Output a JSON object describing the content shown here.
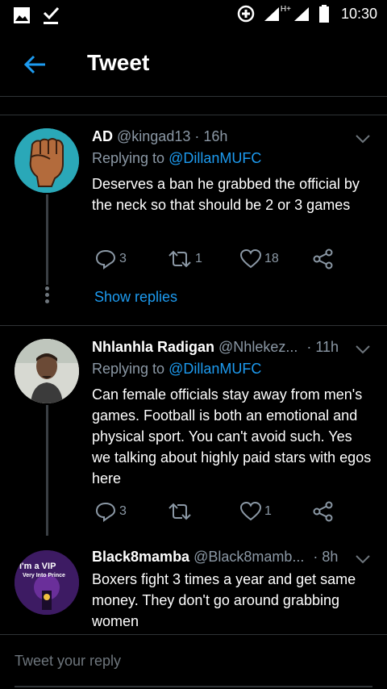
{
  "status_bar": {
    "time": "10:30",
    "network": "H+"
  },
  "header": {
    "title": "Tweet"
  },
  "tweets": [
    {
      "name": "AD",
      "handle": "@kingad13",
      "time": "· 16h",
      "replying_label": "Replying to",
      "replying_to": "@DillanMUFC",
      "text": "Deserves a ban he grabbed the official by the neck so that should be 2 or 3 games",
      "replies": "3",
      "retweets": "1",
      "likes": "18",
      "show_replies": "Show replies"
    },
    {
      "name": "Nhlanhla Radigan",
      "handle": "@Nhlekez...",
      "time": "· 11h",
      "replying_label": "Replying to",
      "replying_to": "@DillanMUFC",
      "text": "Can female officials stay away from men's games.  Football is both an emotional and physical sport. You can't avoid such.  Yes we talking about highly paid stars with egos here",
      "replies": "3",
      "retweets": "",
      "likes": "1"
    },
    {
      "name": "Black8mamba",
      "handle": "@Black8mamb...",
      "time": "· 8h",
      "text": "Boxers fight 3 times a year and get same money. They don't go around grabbing women",
      "avatar_text_1": "I'm a VIP",
      "avatar_text_2": "Very Into Prince"
    }
  ],
  "composer": {
    "placeholder": "Tweet your reply"
  },
  "colors": {
    "background": "#000000",
    "accent": "#1d9bf0",
    "secondary_text": "#8b98a5",
    "divider": "#2f3336"
  }
}
